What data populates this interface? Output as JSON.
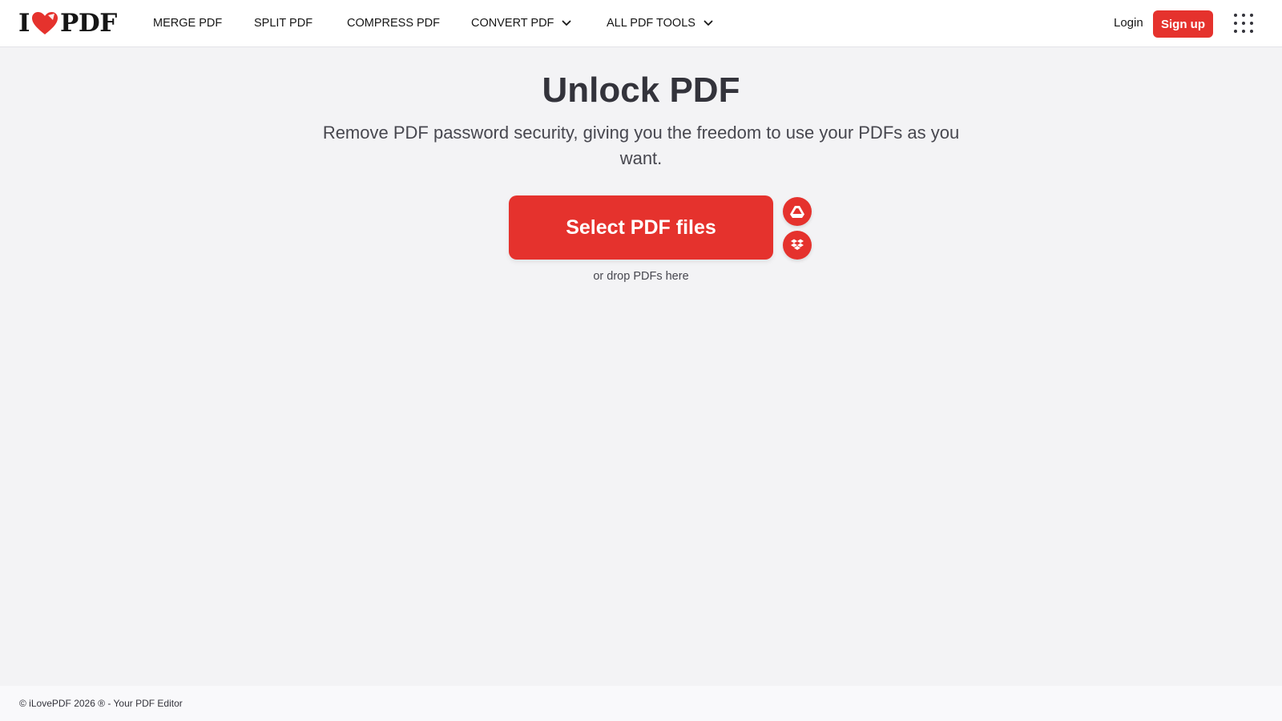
{
  "brand": {
    "logo_left": "I",
    "logo_right": "PDF",
    "accent_color": "#e5322d"
  },
  "nav": {
    "items": [
      {
        "label": "MERGE PDF",
        "has_dropdown": false
      },
      {
        "label": "SPLIT PDF",
        "has_dropdown": false
      },
      {
        "label": "COMPRESS PDF",
        "has_dropdown": false
      },
      {
        "label": "CONVERT PDF",
        "has_dropdown": true
      },
      {
        "label": "ALL PDF TOOLS",
        "has_dropdown": true
      }
    ],
    "login_label": "Login",
    "signup_label": "Sign up",
    "apps_icon": "grid-menu-icon"
  },
  "main": {
    "title": "Unlock PDF",
    "subtitle": "Remove PDF password security, giving you the freedom to use your PDFs as you want.",
    "select_button_label": "Select PDF files",
    "cloud_sources": [
      {
        "icon": "google-drive-icon"
      },
      {
        "icon": "dropbox-icon"
      }
    ],
    "drop_hint": "or drop PDFs here"
  },
  "footer": {
    "text": "© iLovePDF 2026 ® - Your PDF Editor"
  }
}
